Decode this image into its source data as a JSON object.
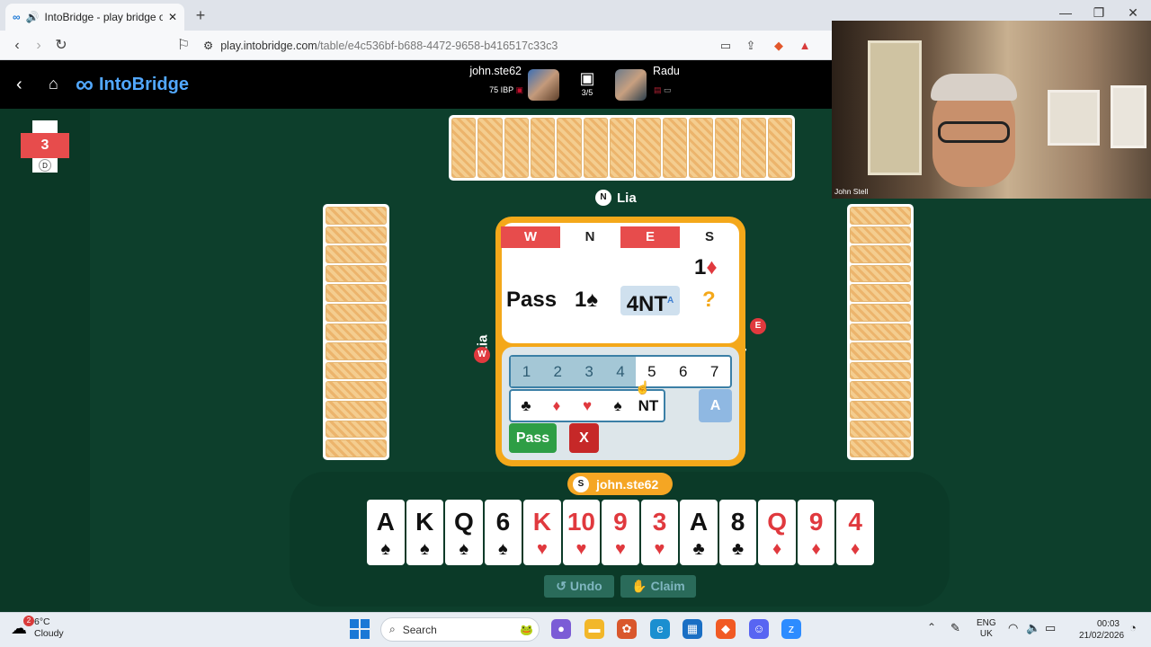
{
  "browser": {
    "tab_title": "IntoBridge - play bridge onlin",
    "url_host": "play.intobridge.com",
    "url_path": "/table/e4c536bf-b688-4472-9658-b416517c33c3"
  },
  "header": {
    "brand": "IntoBridge",
    "player1": {
      "name": "john.ste62",
      "rating": "75 IBP"
    },
    "tournament_progress": "3/5",
    "player2": {
      "name": "Radu"
    }
  },
  "board": {
    "number": "3",
    "dealer": "D"
  },
  "seats": {
    "north": {
      "letter": "N",
      "name": "Lia"
    },
    "west": {
      "letter": "W",
      "name": "Lia"
    },
    "east": {
      "letter": "E",
      "name": "Lia"
    },
    "south": {
      "letter": "S",
      "name": "john.ste62"
    }
  },
  "auction": {
    "headers": [
      "W",
      "N",
      "E",
      "S"
    ],
    "vulnerable_headers": [
      "W",
      "E"
    ],
    "calls": {
      "s1": "1♦",
      "w2": "Pass",
      "n2": "1♠",
      "e2": "4NT",
      "e2_alert": "A",
      "s2": "?"
    }
  },
  "bidding_box": {
    "levels": [
      "1",
      "2",
      "3",
      "4",
      "5",
      "6",
      "7"
    ],
    "unavailable_levels": [
      "1",
      "2",
      "3",
      "4"
    ],
    "strains": [
      "♣",
      "♦",
      "♥",
      "♠",
      "NT"
    ],
    "alert_label": "A",
    "pass_label": "Pass",
    "double_label": "X"
  },
  "south_hand": [
    {
      "rank": "A",
      "suit": "♠",
      "color": "black"
    },
    {
      "rank": "K",
      "suit": "♠",
      "color": "black"
    },
    {
      "rank": "Q",
      "suit": "♠",
      "color": "black"
    },
    {
      "rank": "6",
      "suit": "♠",
      "color": "black"
    },
    {
      "rank": "K",
      "suit": "♥",
      "color": "red"
    },
    {
      "rank": "10",
      "suit": "♥",
      "color": "red"
    },
    {
      "rank": "9",
      "suit": "♥",
      "color": "red"
    },
    {
      "rank": "3",
      "suit": "♥",
      "color": "red"
    },
    {
      "rank": "A",
      "suit": "♣",
      "color": "black"
    },
    {
      "rank": "8",
      "suit": "♣",
      "color": "black"
    },
    {
      "rank": "Q",
      "suit": "♦",
      "color": "red"
    },
    {
      "rank": "9",
      "suit": "♦",
      "color": "red"
    },
    {
      "rank": "4",
      "suit": "♦",
      "color": "red"
    }
  ],
  "opponent_card_counts": {
    "north": 13,
    "west": 13,
    "east": 13
  },
  "actions": {
    "undo": "Undo",
    "claim": "Claim"
  },
  "video": {
    "participant_name": "John Stell"
  },
  "taskbar": {
    "weather_temp": "6°C",
    "weather_desc": "Cloudy",
    "weather_badge": "2",
    "search_placeholder": "Search",
    "lang_line1": "ENG",
    "lang_line2": "UK",
    "time": "00:03",
    "date": "21/02/2026"
  },
  "colors": {
    "table_felt": "#0d3f2c",
    "bidbox_orange": "#f4a81a",
    "vulnerable_red": "#e74c4c",
    "pass_green": "#2e9e45",
    "double_red": "#c62828",
    "brand_blue": "#52a8ff"
  }
}
